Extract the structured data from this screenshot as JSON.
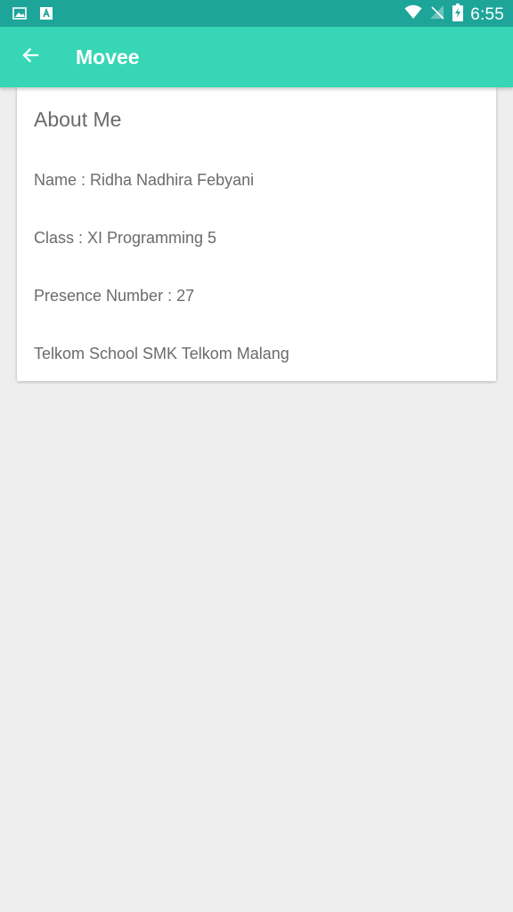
{
  "status_bar": {
    "time": "6:55",
    "icons": [
      "image-icon",
      "a-letter-icon",
      "wifi-icon",
      "no-signal-icon",
      "battery-charging-icon"
    ]
  },
  "app_bar": {
    "title": "Movee",
    "back_icon": "arrow-left-icon",
    "color": "#36d6b6"
  },
  "card": {
    "title": "About Me",
    "lines": [
      "Name : Ridha Nadhira Febyani",
      "Class : XI Programming 5",
      "Presence Number : 27",
      "Telkom School SMK Telkom Malang"
    ]
  },
  "colors": {
    "status_bar": "#1ea59a",
    "background": "#eeeeee",
    "text": "#6b6b6b"
  }
}
